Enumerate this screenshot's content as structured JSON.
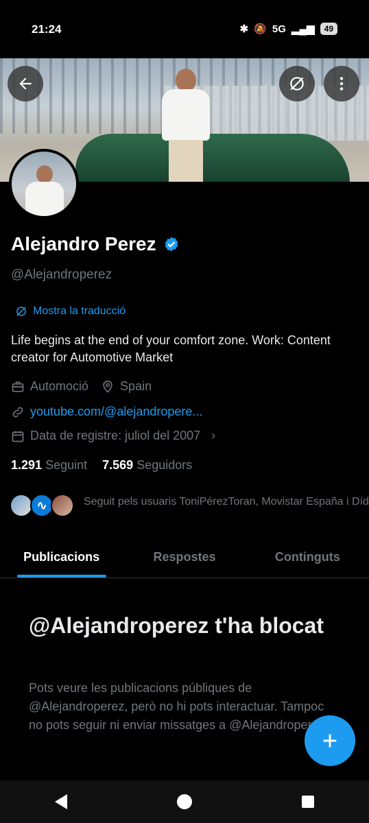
{
  "status": {
    "time": "21:24",
    "network": "5G",
    "battery": "49"
  },
  "profile": {
    "name": "Alejandro Perez",
    "handle": "@Alejandroperez",
    "translate_label": "Mostra la traducció",
    "bio": "Life begins at the end of your comfort zone. Work: Content creator for Automotive Market",
    "category": "Automoció",
    "location": "Spain",
    "website": "youtube.com/@alejandropere...",
    "joined": "Data de registre: juliol del 2007",
    "following_count": "1.291",
    "following_label": "Seguint",
    "followers_count": "7.569",
    "followers_label": "Seguidors",
    "followed_by": "Seguit pels usuaris ToniPérezToran, Movistar España i Dídac"
  },
  "tabs": [
    {
      "label": "Publicacions",
      "active": true
    },
    {
      "label": "Respostes",
      "active": false
    },
    {
      "label": "Continguts",
      "active": false
    }
  ],
  "blocked": {
    "title": "@Alejandroperez t'ha blocat",
    "text": "Pots veure les publicacions públiques de @Alejandroperez, però no hi pots interactuar. Tampoc no pots seguir ni enviar missatges a @Alejandroperez."
  },
  "colors": {
    "accent": "#1d9bf0",
    "muted": "#71767b",
    "background": "#000000"
  },
  "icons": [
    "back-arrow-icon",
    "translate-icon",
    "more-vertical-icon",
    "verified-badge-icon",
    "briefcase-icon",
    "location-pin-icon",
    "link-icon",
    "calendar-icon",
    "plus-icon"
  ]
}
